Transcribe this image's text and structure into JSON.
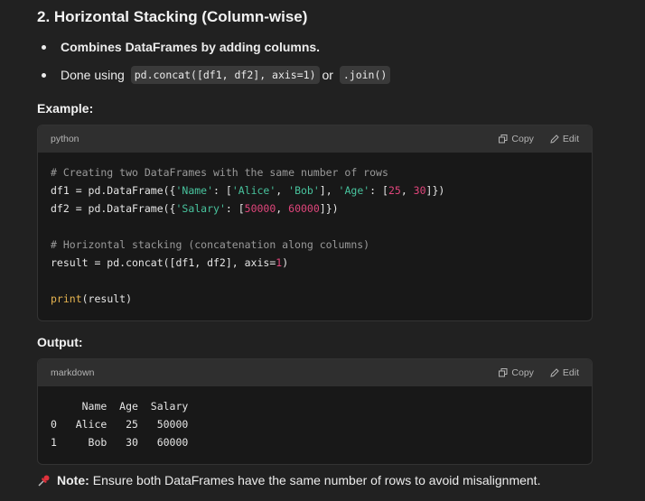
{
  "heading": "2. Horizontal Stacking (Column-wise)",
  "bullets": {
    "b1": "Combines DataFrames by adding columns.",
    "b2_prefix": "Done using",
    "b2_code1": "pd.concat([df1, df2], axis=1)",
    "b2_or": "or",
    "b2_code2": ".join()"
  },
  "example_label": "Example:",
  "output_label": "Output:",
  "block1": {
    "lang": "python",
    "copy": "Copy",
    "edit": "Edit",
    "lines": {
      "l1": "# Creating two DataFrames with the same number of rows",
      "l2_a": "df1 = pd.DataFrame({",
      "l2_b": "'Name'",
      "l2_c": ": [",
      "l2_d": "'Alice'",
      "l2_e": ", ",
      "l2_f": "'Bob'",
      "l2_g": "], ",
      "l2_h": "'Age'",
      "l2_i": ": [",
      "l2_j": "25",
      "l2_k": ", ",
      "l2_l": "30",
      "l2_m": "]})",
      "l3_a": "df2 = pd.DataFrame({",
      "l3_b": "'Salary'",
      "l3_c": ": [",
      "l3_d": "50000",
      "l3_e": ", ",
      "l3_f": "60000",
      "l3_g": "]})",
      "l5": "# Horizontal stacking (concatenation along columns)",
      "l6_a": "result = pd.concat([df1, df2], axis=",
      "l6_b": "1",
      "l6_c": ")",
      "l8_a": "print",
      "l8_b": "(result)"
    }
  },
  "block2": {
    "lang": "markdown",
    "copy": "Copy",
    "edit": "Edit",
    "output": "     Name  Age  Salary\n0   Alice   25   50000\n1     Bob   30   60000"
  },
  "note": {
    "icon": "pushpin-icon",
    "label": "Note:",
    "text": "Ensure both DataFrames have the same number of rows to avoid misalignment."
  }
}
